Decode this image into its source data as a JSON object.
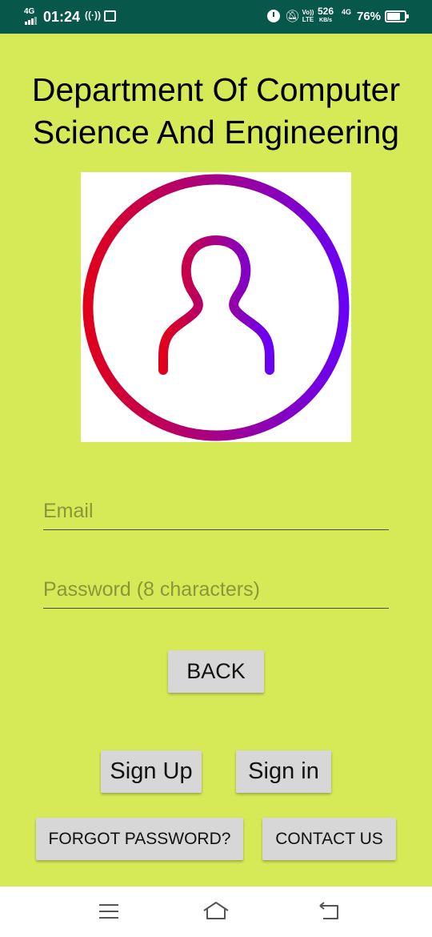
{
  "status_bar": {
    "network_left": "4G",
    "time": "01:24",
    "hotspot": "((·))",
    "volte": "Vo)) LTE",
    "speed_value": "526",
    "speed_unit": "KB/s",
    "network_right": "4G",
    "battery_percent": "76%",
    "battery_level": 0.76
  },
  "header": {
    "title_line1": "Department Of Computer",
    "title_line2": "Science And Engineering"
  },
  "logo": {
    "icon": "user-profile-icon",
    "gradient_start": "#e0001b",
    "gradient_end": "#6a00f4"
  },
  "form": {
    "email_placeholder": "Email",
    "email_value": "",
    "password_placeholder": "Password (8 characters)",
    "password_value": ""
  },
  "buttons": {
    "back": "BACK",
    "sign_up": "Sign Up",
    "sign_in": "Sign in",
    "forgot_password": "FORGOT PASSWORD?",
    "contact_us": "CONTACT US"
  },
  "nav": {
    "menu_icon": "menu-icon",
    "home_icon": "home-icon",
    "back_icon": "back-icon"
  },
  "colors": {
    "background": "#d6ea58",
    "status_bar": "#07574b",
    "button": "#d7d7d7",
    "placeholder": "#8a9637"
  }
}
